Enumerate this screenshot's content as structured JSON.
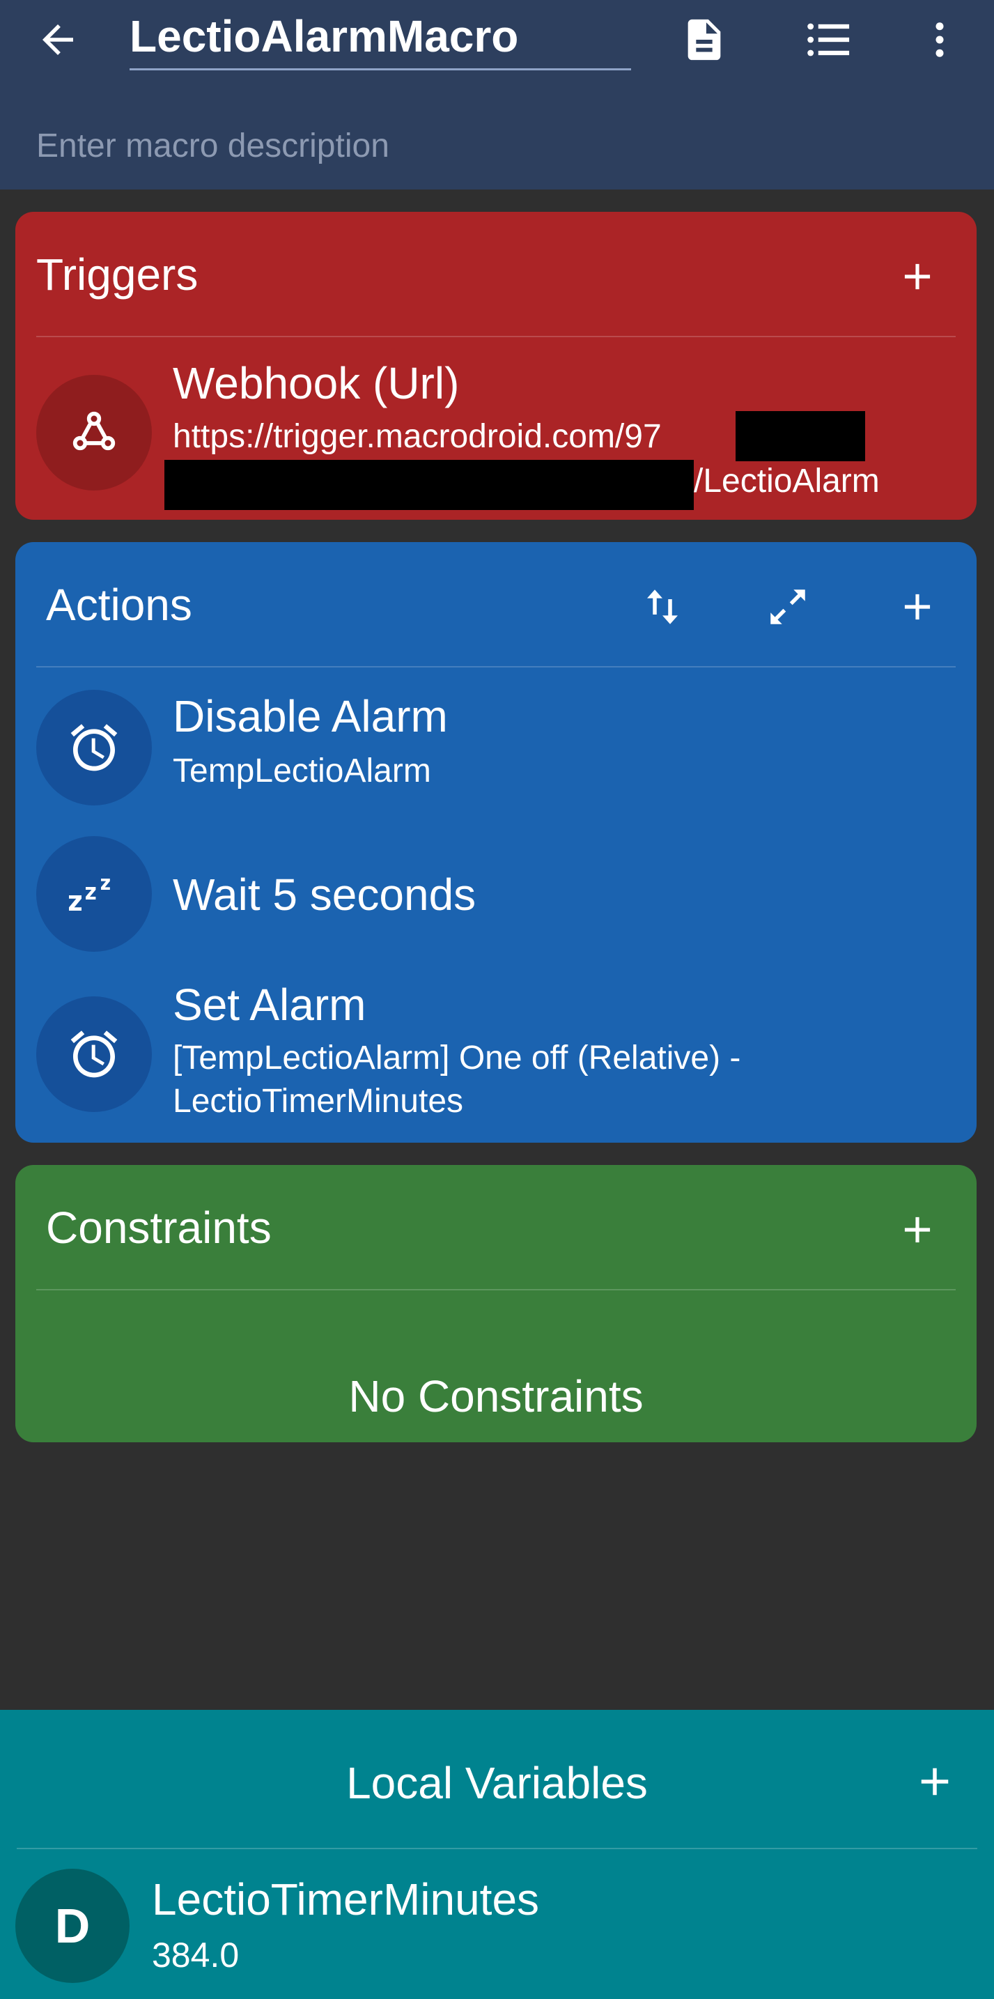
{
  "header": {
    "macro_name": "LectioAlarmMacro",
    "description_placeholder": "Enter macro description",
    "icons": [
      "back-arrow-icon",
      "document-icon",
      "list-icon",
      "more-vertical-icon"
    ]
  },
  "triggers": {
    "title": "Triggers",
    "items": [
      {
        "icon": "webhook-icon",
        "title": "Webhook (Url)",
        "line1": "https://trigger.macrodroid.com/97",
        "line2": "/LectioAlarm"
      }
    ]
  },
  "actions": {
    "title": "Actions",
    "items": [
      {
        "icon": "alarm-clock-icon",
        "title": "Disable Alarm",
        "subtitle": "TempLectioAlarm"
      },
      {
        "icon": "zzz-icon",
        "title": "Wait 5 seconds"
      },
      {
        "icon": "alarm-clock-icon",
        "title": "Set Alarm",
        "subtitle1": "[TempLectioAlarm] One off (Relative) -",
        "subtitle2": "LectioTimerMinutes"
      }
    ]
  },
  "constraints": {
    "title": "Constraints",
    "empty_text": "No Constraints"
  },
  "local_variables": {
    "title": "Local Variables",
    "items": [
      {
        "type_letter": "D",
        "name": "LectioTimerMinutes",
        "value": "384.0"
      }
    ]
  },
  "colors": {
    "header": "#2d3f5e",
    "triggers": "#ab2426",
    "actions": "#1b63b0",
    "constraints": "#3a7f3b",
    "local_variables": "#00838f",
    "background": "#2f2f2f"
  }
}
